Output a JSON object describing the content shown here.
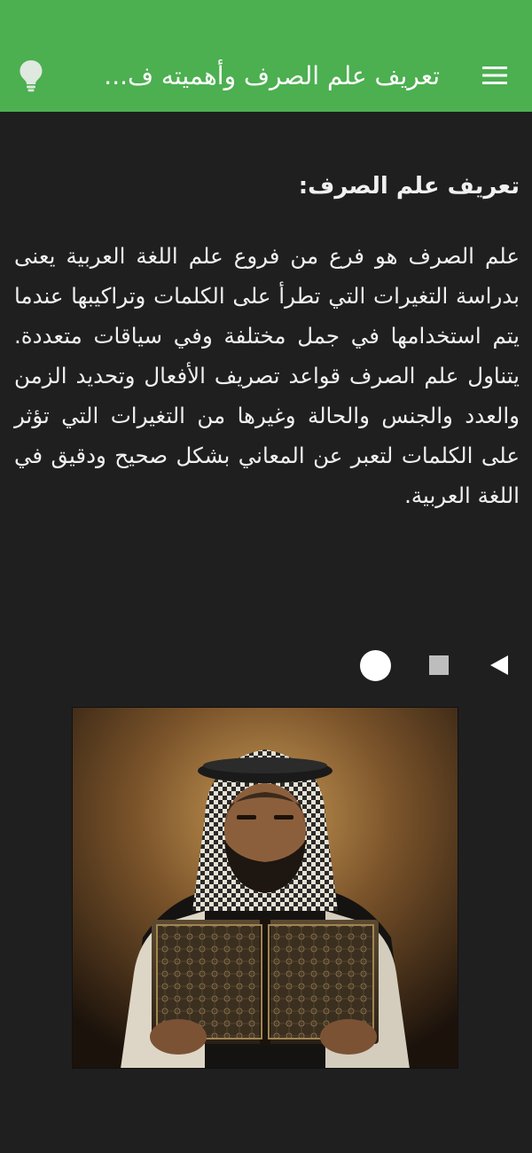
{
  "header": {
    "title": "تعريف علم الصرف وأهميته ف...",
    "menu_icon": "hamburger-menu-icon",
    "bulb_icon": "lightbulb-icon",
    "accent_color": "#4caf50"
  },
  "article": {
    "heading": "تعريف علم الصرف:",
    "paragraph": "علم الصرف هو فرع من فروع علم اللغة العربية يعنى بدراسة التغيرات التي تطرأ على الكلمات وتراكيبها عندما يتم استخدامها في جمل مختلفة وفي سياقات متعددة. يتناول علم الصرف قواعد تصريف الأفعال وتحديد الزمن والعدد والجنس والحالة وغيرها من التغيرات التي تؤثر على الكلمات لتعبر عن المعاني بشكل صحيح ودقيق في اللغة العربية."
  },
  "navigation": {
    "back_icon": "triangle-back-icon",
    "recents_icon": "square-recents-icon",
    "home_icon": "circle-home-icon"
  },
  "image": {
    "subject": "bearded man in keffiyeh holding an old ornate book"
  }
}
